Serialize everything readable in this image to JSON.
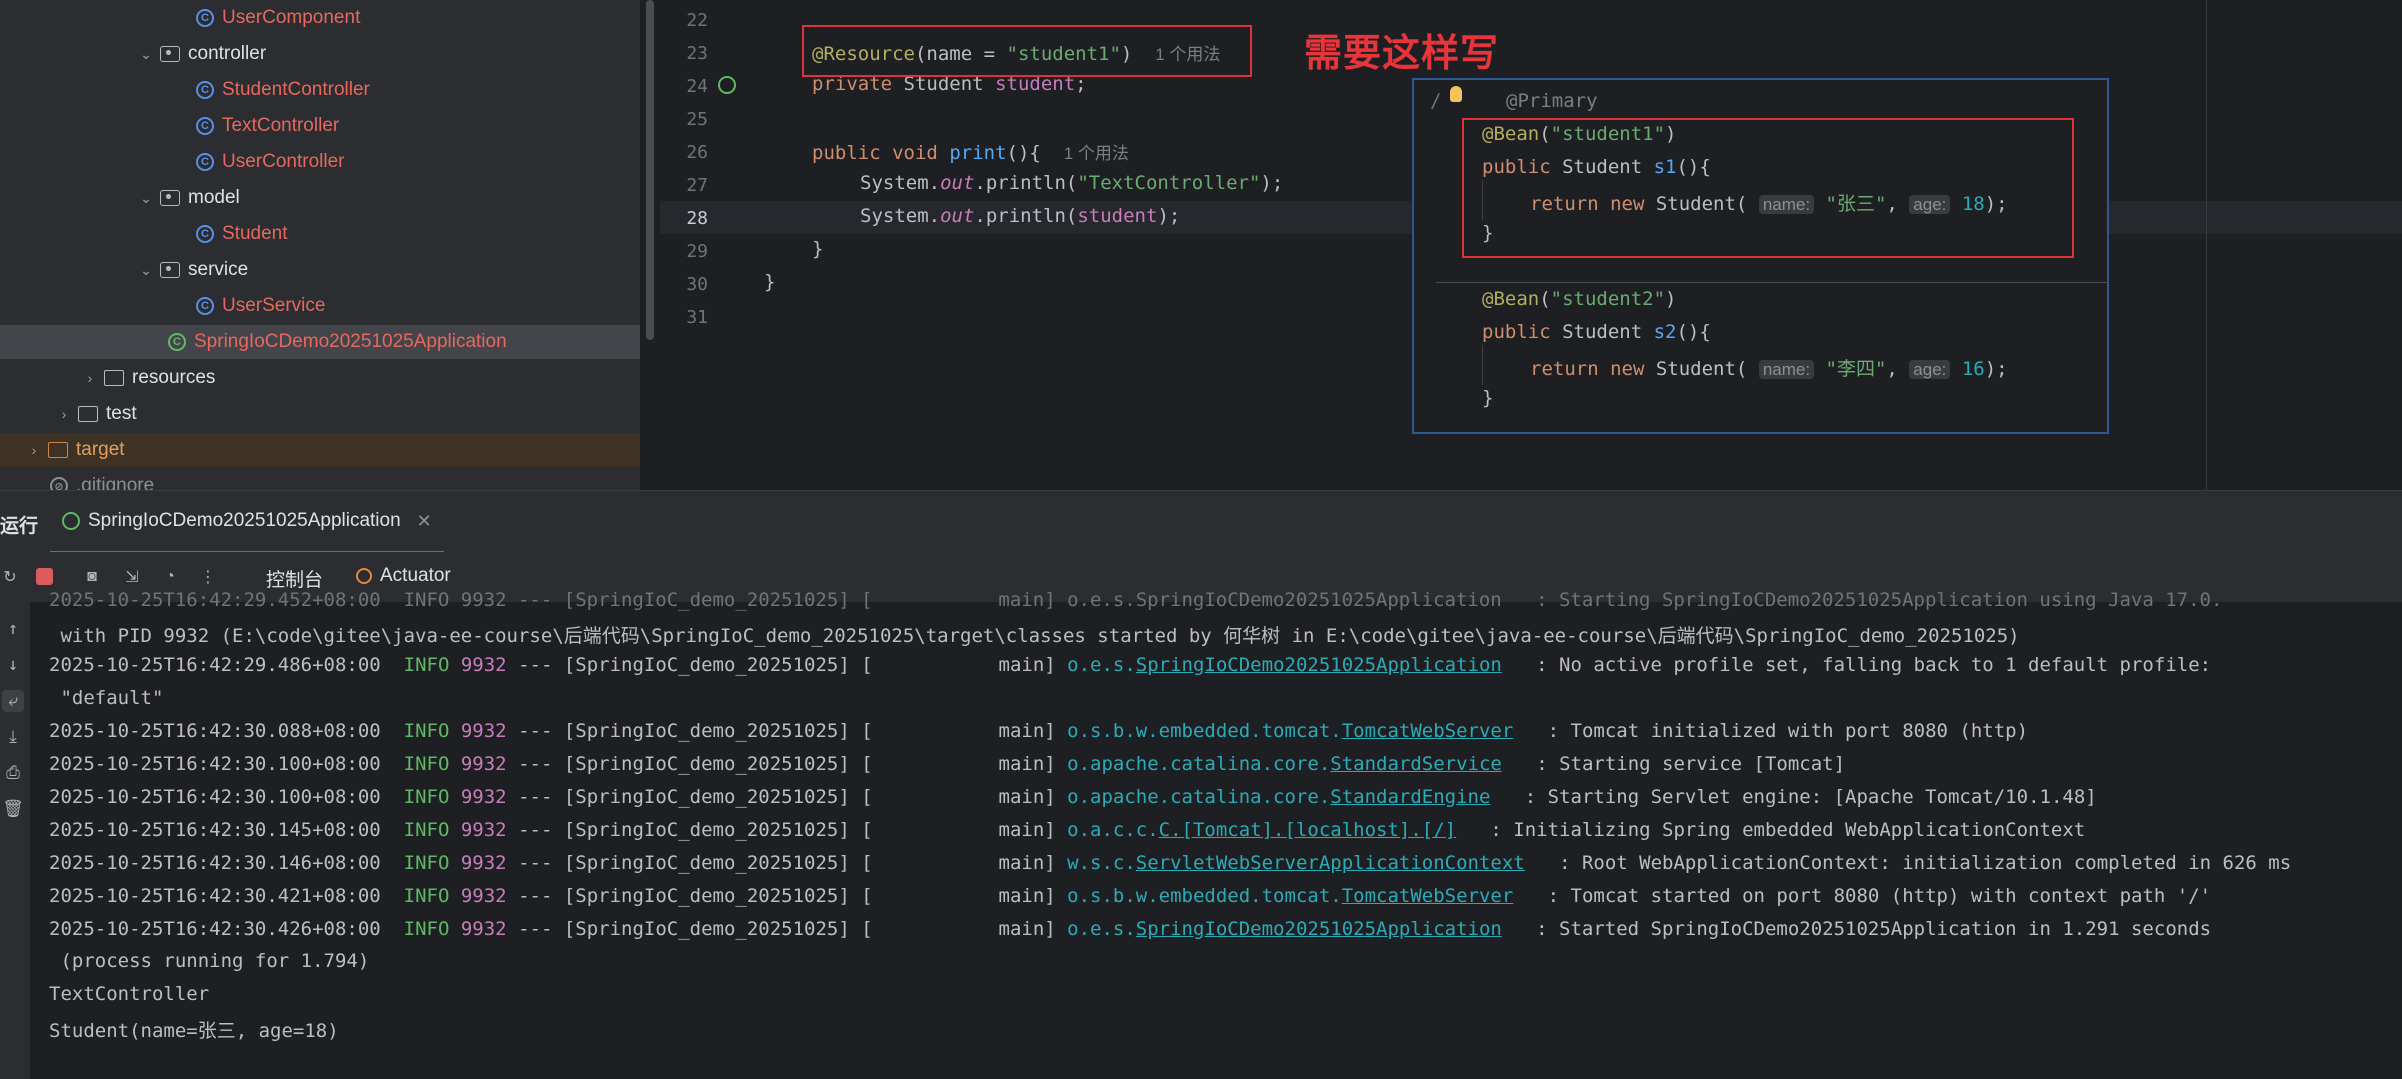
{
  "project_tree": {
    "items": [
      {
        "label": "UserComponent",
        "kind": "class"
      },
      {
        "label": "controller",
        "kind": "package"
      },
      {
        "label": "StudentController",
        "kind": "class"
      },
      {
        "label": "TextController",
        "kind": "class"
      },
      {
        "label": "UserController",
        "kind": "class"
      },
      {
        "label": "model",
        "kind": "package"
      },
      {
        "label": "Student",
        "kind": "class"
      },
      {
        "label": "service",
        "kind": "package"
      },
      {
        "label": "UserService",
        "kind": "class"
      },
      {
        "label": "SpringIoCDemo20251025Application",
        "kind": "spring-app"
      },
      {
        "label": "resources",
        "kind": "folder"
      },
      {
        "label": "test",
        "kind": "folder"
      },
      {
        "label": "target",
        "kind": "folder"
      },
      {
        "label": ".gitignore",
        "kind": "file"
      }
    ]
  },
  "editor": {
    "line_numbers": [
      "22",
      "23",
      "24",
      "25",
      "26",
      "27",
      "28",
      "29",
      "30",
      "31"
    ],
    "annotation_resource": "@Resource",
    "resource_name_key": "name",
    "resource_name_value": "\"student1\"",
    "usage_hint_1": "1 个用法",
    "private_kw": "private",
    "type_student": "Student",
    "field_student": "student",
    "public_kw": "public",
    "void_kw": "void",
    "method_print": "print",
    "usage_hint_2": "1 个用法",
    "system": "System.",
    "out": "out",
    "println": ".println(",
    "str_text_controller": "\"TextController\"",
    "note": "需要这样写"
  },
  "popup": {
    "primary": "@Primary",
    "bean1_ann": "@Bean",
    "bean1_name": "\"student1\"",
    "bean1_method": "s1",
    "bean1_param_name_hint": "name:",
    "bean1_name_value": "\"张三\"",
    "bean1_param_age_hint": "age:",
    "bean1_age_value": "18",
    "bean2_ann": "@Bean",
    "bean2_name": "\"student2\"",
    "bean2_method": "s2",
    "bean2_param_name_hint": "name:",
    "bean2_name_value": "\"李四\"",
    "bean2_param_age_hint": "age:",
    "bean2_age_value": "16",
    "return_kw": "return",
    "new_kw": "new"
  },
  "run_panel": {
    "label": "运行",
    "tab_label": "SpringIoCDemo20251025Application",
    "console_tab": "控制台",
    "actuator_tab": "Actuator"
  },
  "console": {
    "top_partial": "2025-10-25T16:42:29.452+08:00  INFO 9932 --- [SpringIoC_demo_20251025] [           main] o.e.s.SpringIoCDemo20251025Application   : Starting SpringIoCDemo20251025Application using Java 17.0.",
    "pid_line": " with PID 9932 (E:\\code\\gitee\\java-ee-course\\后端代码\\SpringIoC_demo_20251025\\target\\classes started by 何华树 in E:\\code\\gitee\\java-ee-course\\后端代码\\SpringIoC_demo_20251025)",
    "prefix_time_1": "2025-10-25T16:42:29.486+08:00",
    "logs": [
      {
        "time": "2025-10-25T16:42:29.486+08:00",
        "level": "INFO",
        "pid": "9932",
        "app": "--- [SpringIoC_demo_20251025] [           main]",
        "logger_pkg": "o.e.s.",
        "logger_cls": "SpringIoCDemo20251025Application",
        "msg": ": No active profile set, falling back to 1 default profile:"
      },
      {
        "time": "2025-10-25T16:42:30.088+08:00",
        "level": "INFO",
        "pid": "9932",
        "app": "--- [SpringIoC_demo_20251025] [           main]",
        "logger_pkg": "o.s.b.w.embedded.tomcat.",
        "logger_cls": "TomcatWebServer",
        "msg": ": Tomcat initialized with port 8080 (http)"
      },
      {
        "time": "2025-10-25T16:42:30.100+08:00",
        "level": "INFO",
        "pid": "9932",
        "app": "--- [SpringIoC_demo_20251025] [           main]",
        "logger_pkg": "o.apache.catalina.core.",
        "logger_cls": "StandardService",
        "msg": ": Starting service [Tomcat]"
      },
      {
        "time": "2025-10-25T16:42:30.100+08:00",
        "level": "INFO",
        "pid": "9932",
        "app": "--- [SpringIoC_demo_20251025] [           main]",
        "logger_pkg": "o.apache.catalina.core.",
        "logger_cls": "StandardEngine",
        "msg": ": Starting Servlet engine: [Apache Tomcat/10.1.48]"
      },
      {
        "time": "2025-10-25T16:42:30.145+08:00",
        "level": "INFO",
        "pid": "9932",
        "app": "--- [SpringIoC_demo_20251025] [           main]",
        "logger_pkg": "o.a.c.c.",
        "logger_cls": "C.[Tomcat].[localhost].[/]",
        "msg": ": Initializing Spring embedded WebApplicationContext"
      },
      {
        "time": "2025-10-25T16:42:30.146+08:00",
        "level": "INFO",
        "pid": "9932",
        "app": "--- [SpringIoC_demo_20251025] [           main]",
        "logger_pkg": "w.s.c.",
        "logger_cls": "ServletWebServerApplicationContext",
        "msg": ": Root WebApplicationContext: initialization completed in 626 ms"
      },
      {
        "time": "2025-10-25T16:42:30.421+08:00",
        "level": "INFO",
        "pid": "9932",
        "app": "--- [SpringIoC_demo_20251025] [           main]",
        "logger_pkg": "o.s.b.w.embedded.tomcat.",
        "logger_cls": "TomcatWebServer",
        "msg": ": Tomcat started on port 8080 (http) with context path '/'"
      },
      {
        "time": "2025-10-25T16:42:30.426+08:00",
        "level": "INFO",
        "pid": "9932",
        "app": "--- [SpringIoC_demo_20251025] [           main]",
        "logger_pkg": "o.e.s.",
        "logger_cls": "SpringIoCDemo20251025Application",
        "msg": ": Started SpringIoCDemo20251025Application in 1.291 seconds"
      }
    ],
    "default_cont": " \"default\"",
    "process_cont": " (process running for 1.794)",
    "out_1": "TextController",
    "out_2": "Student(name=张三, age=18)"
  }
}
